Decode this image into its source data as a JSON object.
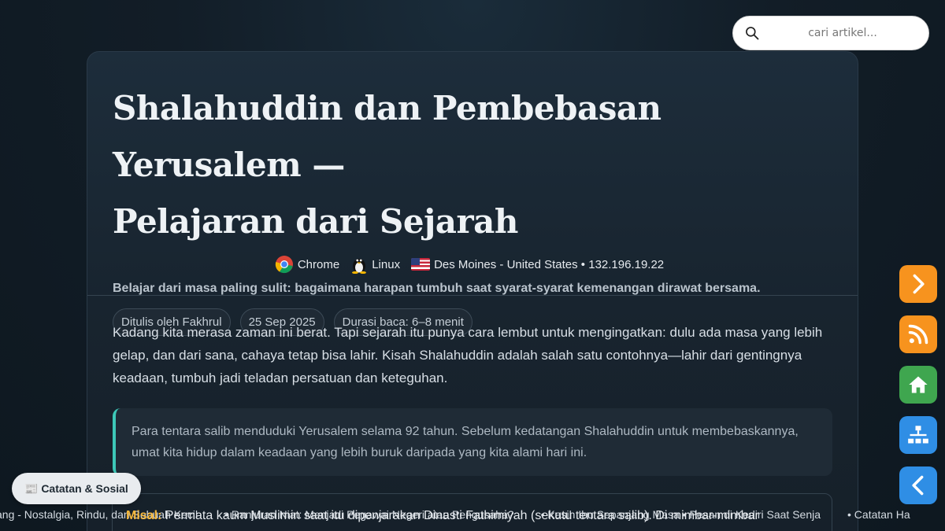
{
  "search": {
    "placeholder": "cari artikel..."
  },
  "article": {
    "title_line1": "Shalahuddin dan Pembebasan Yerusalem —",
    "title_line2": "Pelajaran dari Sejarah",
    "meta": {
      "browser": "Chrome",
      "os": "Linux",
      "location": "Des Moines - United States • 132.196.19.22"
    },
    "subtitle": "Belajar dari masa paling sulit: bagaimana harapan tumbuh saat syarat-syarat kemenangan dirawat bersama.",
    "pills": [
      "Ditulis oleh Fakhrul",
      "25 Sep 2025",
      "Durasi baca: 6–8 menit"
    ],
    "paragraph": "Kadang kita merasa zaman ini berat. Tapi sejarah itu punya cara lembut untuk mengingatkan: dulu ada masa yang lebih gelap, dan dari sana, cahaya tetap bisa lahir. Kisah Shalahuddin adalah salah satu contohnya—lahir dari gentingnya keadaan, tumbuh jadi teladan persatuan dan keteguhan.",
    "quote": "Para tentara salib menduduki Yerusalem selama 92 tahun. Sebelum kedatangan Shalahuddin untuk membebaskannya, umat kita hidup dalam keadaan yang lebih buruk daripada yang kita alami hari ini."
  },
  "side_buttons": [
    {
      "icon": "chevron-right-icon",
      "color": "#f7931e"
    },
    {
      "icon": "rss-icon",
      "color": "#f7931e"
    },
    {
      "icon": "home-icon",
      "color": "#3fa64f"
    },
    {
      "icon": "sitemap-icon",
      "color": "#2f8ee5"
    },
    {
      "icon": "chevron-left-icon",
      "color": "#2f8ee5"
    }
  ],
  "badge": {
    "label": "📰 Catatan & Sosial"
  },
  "ticker": {
    "items": [
      "ang - Nostalgia, Rindu, dan Sebuah Kecil",
      "• Ranjuran Niat: Menjadi Pegawai Negeri atau Pengusaha?",
      "• Kasih Ibu Sepanjang Masa • Pesan di Kediri Saat Senja",
      "• Catatan Ha"
    ],
    "overlay_label": "Misal:",
    "overlay_text": " Permata kaum Muslimin saat itu dipenjarakan Dinasti Fathimiyah (sekutu tentara salib). Di mimbar-mimbar"
  }
}
